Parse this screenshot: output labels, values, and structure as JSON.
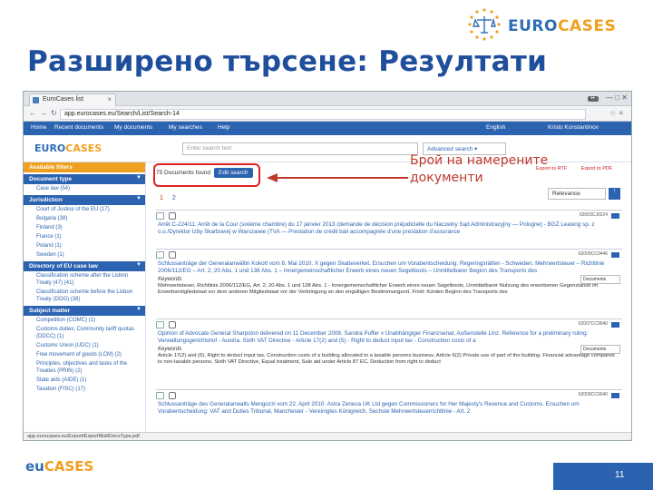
{
  "slide": {
    "title": "Разширено търсене: Резултати",
    "annotation_line1": "Брой на намерените",
    "annotation_line2": "документи",
    "page_number": "11",
    "logo_top_a": "EURO",
    "logo_top_b": "CASES",
    "footer_logo_a": "eu",
    "footer_logo_b": "CASES"
  },
  "browser": {
    "tab_title": "EuroCases list",
    "tab_close": "×",
    "url": "app.eurocases.eu/Search/List/Search-14",
    "status_url": "app.eurocases.eu/Export/ExportMultiDocsType.pdf"
  },
  "app_nav": {
    "home": "Home",
    "recent": "Recent documents",
    "my_documents": "My documents",
    "my_searches": "My searches",
    "help": "Help",
    "language": "English",
    "user": "Kristo Konstantinov"
  },
  "app_header": {
    "brand_a": "EURO",
    "brand_b": "CASES",
    "search_placeholder": "Enter search text",
    "advanced": "Advanced search ▾"
  },
  "sidebar": {
    "header": "Available filters",
    "sections": [
      {
        "title": "Document type",
        "items": [
          "Case law (54)"
        ]
      },
      {
        "title": "Jurisdiction",
        "items": [
          "Court of Justice of the EU (17)",
          "Bulgaria (38)",
          "Finland (3)",
          "France (1)",
          "Poland (1)",
          "Sweden (1)"
        ]
      },
      {
        "title": "Directory of EU case law",
        "items": [
          "Classification scheme after the Lisbon Treaty (47) (41)",
          "Classification scheme before the Lisbon Treaty (DOG) (38)"
        ]
      },
      {
        "title": "Subject matter",
        "items": [
          "Competition (COMC) (1)",
          "Customs duties, Community tariff quotas (DDCC) (1)",
          "Customs Union (UDC) (1)",
          "Free movement of goods (LCM) (2)",
          "Principles, objectives and tasks of the Treaties (PRIN) (2)",
          "State aids (AIDE) (1)",
          "Taxation (FISC) (17)"
        ]
      }
    ]
  },
  "main": {
    "found_text": "75 Documents found",
    "edit_search": "Edit search",
    "pages": [
      "1",
      "2"
    ],
    "export_rtf": "Export to RTF",
    "export_pdf": "Export to PDF",
    "sort_label": "Relevance",
    "sort_btn": "↑"
  },
  "results": [
    {
      "number": "62003CJ0224",
      "title": "Arrêt C-224/11. Arrêt de la Cour (sixième chambre) du 17 janvier 2013 (demande de décision préjudicielle du Naczelny Sąd Administracyjny — Pologne) - BGŻ Leasing sp. z o.o./Dyrektor Izby Skarbowej w Warszawie (TVA — Prestation de crédit bail accompagnée d'une prestation d'assurance",
      "keywords": "",
      "doc_select": "",
      "snippet": ""
    },
    {
      "number": "62009CC0446",
      "title": "Schlussanträge der Generalanwältin Kokott vom 6. Mai 2010. X gegen Skatteverket. Ersuchen um Vorabentscheidung: Regeringsrätten - Schweden. Mehrwertsteuer – Richtlinie 2006/112/EG – Art. 2, 20 Abs. 1 und 138 Abs. 1 – Innergemeinschaftlicher Erwerb eines neuen Segelboots – Unmittelbarer Beginn des Transports des",
      "keywords": "Keywords",
      "doc_select": "Documents",
      "snippet": "Mehrwertsteuer, Richtlinie 2006/112/EG, Art. 2, 20 Abs. 1 und 138 Abs. 1 - Innergemeinschaftlicher Erwerb eines neuen Segelboots, Unmittelbarer Nutzung des erworbenen Gegenstands im Erwerbsmitgliedstaat vor dem anderen Mitgliedstaat vor der Verbringung an den engültigen Bestimmungsort. Fristt: Kürden Beginn des Transports des"
    },
    {
      "number": "62007CC0040",
      "title": "Opinion of Advocate General Sharpston delivered on 11 December 2008. Sandra Puffer v Unabhängiger Finanzsenat, Außenstelle Linz. Reference for a preliminary ruling: Verwaltungsgerichtshof - Austria. Sixth VAT Directive - Article 17(2) and (5) - Right to deduct input tax - Construction costs of a",
      "keywords": "Keywords",
      "doc_select": "Documents",
      "snippet": "Article 17(2) and (6), Right to deduct input tax, Construction costs of a building allocated to a taxable persons business, Article 6(2) Private use of part of the building. Financial advantage compared to non-taxable persons, Sixth VAT Directive, Equal treatment, Sale aid under Article 87 EC, Deduction from right to deduct"
    },
    {
      "number": "62009CC0040",
      "title": "Schlussanträge des Generalanwalts Mengozzi vom 22. April 2010. Astra Zeneca UK Ltd gegen Commissioners for Her Majesty's Revenue and Customs. Ersuchen um Vorabentscheidung: VAT and Duties Tribunal, Manchester - Vereinigtes Königreich. Sechste Mehrwertsteuerrichtlinie - Art. 2",
      "keywords": "",
      "doc_select": "",
      "snippet": ""
    }
  ],
  "colors": {
    "title_blue": "#1f4e9c",
    "app_blue": "#2c63b0",
    "accent_orange": "#f0a020",
    "highlight_red": "#d22222"
  }
}
